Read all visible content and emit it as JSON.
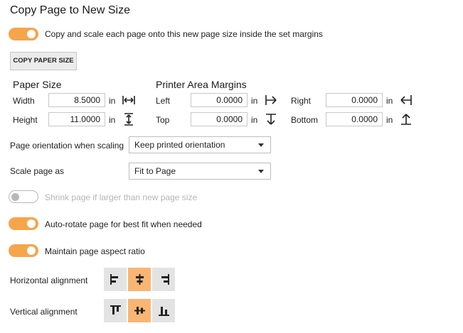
{
  "title": "Copy Page to New Size",
  "copy_scale": {
    "label": "Copy and scale each page onto this new page size inside the set margins",
    "on": true
  },
  "copy_paper_size_button": "COPY PAPER SIZE",
  "paper_size": {
    "heading": "Paper Size",
    "width_label": "Width",
    "width_value": "8.5000",
    "height_label": "Height",
    "height_value": "11.0000",
    "unit": "in"
  },
  "margins": {
    "heading": "Printer Area Margins",
    "left_label": "Left",
    "left_value": "0.0000",
    "top_label": "Top",
    "top_value": "0.0000",
    "right_label": "Right",
    "right_value": "0.0000",
    "bottom_label": "Bottom",
    "bottom_value": "0.0000",
    "unit": "in"
  },
  "orientation": {
    "label": "Page orientation when scaling",
    "value": "Keep printed orientation"
  },
  "scale": {
    "label": "Scale page as",
    "value": "Fit to Page"
  },
  "shrink": {
    "label": "Shrink page if larger than new page size",
    "on": false,
    "disabled": true
  },
  "autorotate": {
    "label": "Auto-rotate page for best fit when needed",
    "on": true
  },
  "aspect": {
    "label": "Maintain page aspect ratio",
    "on": true
  },
  "horizontal_alignment": {
    "label": "Horizontal alignment",
    "selected": "center"
  },
  "vertical_alignment": {
    "label": "Vertical alignment",
    "selected": "center"
  },
  "colors": {
    "accent": "#f7a54a",
    "selected_button": "#f9b574",
    "button": "#e3e3e3"
  }
}
